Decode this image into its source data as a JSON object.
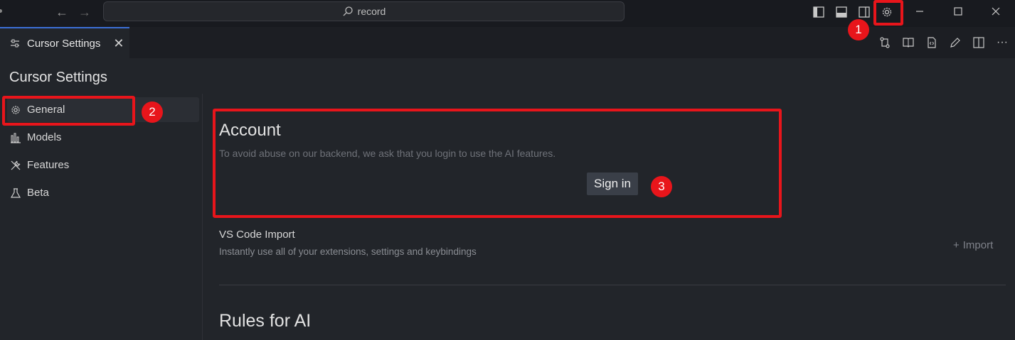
{
  "titlebar": {
    "back_icon": "arrow-left-icon",
    "forward_icon": "arrow-right-icon",
    "search_text": "record"
  },
  "tab": {
    "label": "Cursor Settings",
    "close": "✕"
  },
  "page": {
    "title": "Cursor Settings"
  },
  "sidebar": {
    "items": [
      {
        "label": "General",
        "icon": "gear-icon"
      },
      {
        "label": "Models",
        "icon": "bar-chart-icon"
      },
      {
        "label": "Features",
        "icon": "tools-icon"
      },
      {
        "label": "Beta",
        "icon": "flask-icon"
      }
    ]
  },
  "account": {
    "title": "Account",
    "description": "To avoid abuse on our backend, we ask that you login to use the AI features.",
    "signin_label": "Sign in"
  },
  "vscode_import": {
    "title": "VS Code Import",
    "description": "Instantly use all of your extensions, settings and keybindings",
    "import_label": "Import",
    "import_symbol": "+"
  },
  "rules": {
    "title": "Rules for AI"
  },
  "annotations": {
    "badge1": "1",
    "badge2": "2",
    "badge3": "3",
    "color": "#e8151b"
  },
  "colors": {
    "accent": "#3c6fd6",
    "background": "#22252a"
  }
}
